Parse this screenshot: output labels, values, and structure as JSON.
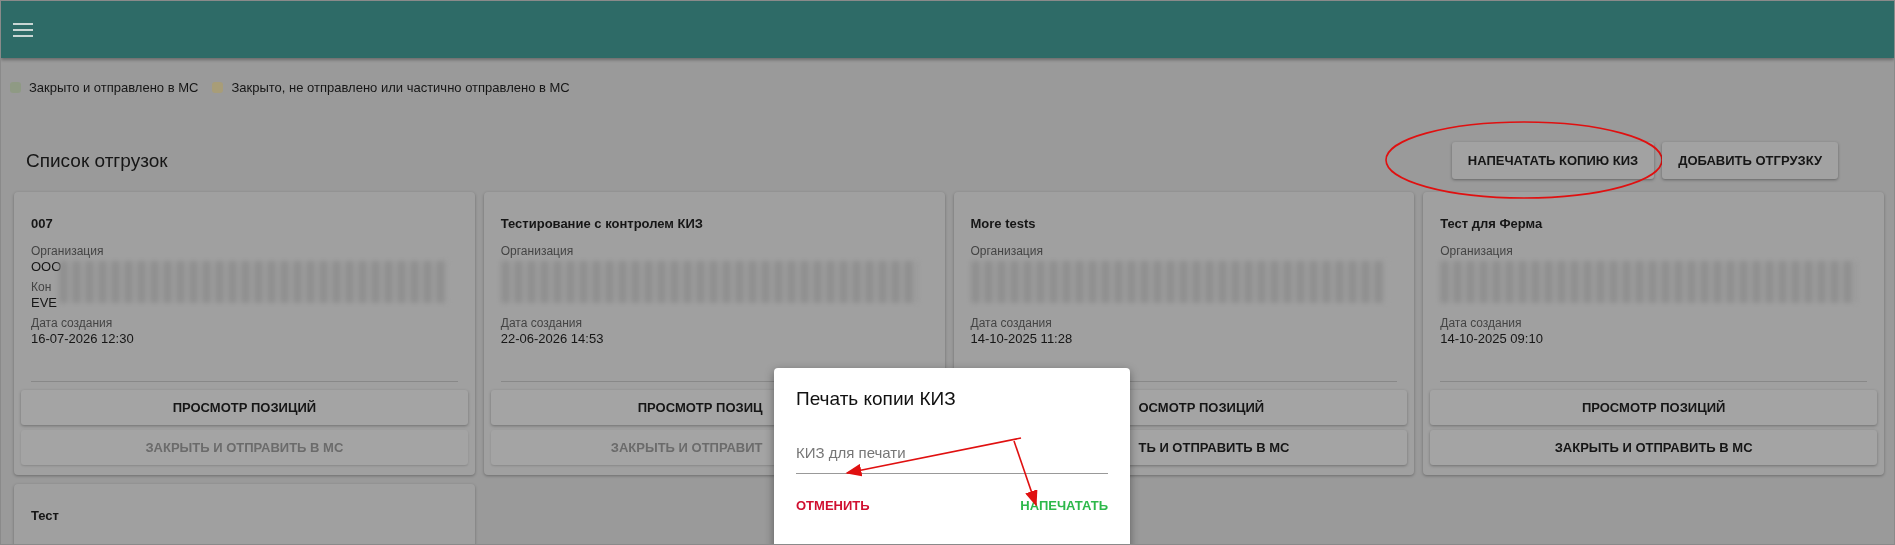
{
  "legend": [
    {
      "label": "Закрыто и отправлено в МС",
      "color": "#8f9a84"
    },
    {
      "label": "Закрыто, не отправлено или частично отправлено в МС",
      "color": "#a89d78"
    }
  ],
  "page_title": "Список отгрузок",
  "actions": [
    {
      "label": "НАПЕЧАТАТЬ КОПИЮ КИЗ",
      "circled": true
    },
    {
      "label": "ДОБАВИТЬ ОТГРУЗКУ",
      "circled": false
    }
  ],
  "cards": [
    {
      "title": "007",
      "org_label": "Организация",
      "org_value": "ООО",
      "contractor_label": "Кон",
      "contractor_value": "EVE",
      "date_label": "Дата создания",
      "date": "16-07-2026 12:30",
      "buttons": [
        {
          "label": "ПРОСМОТР ПОЗИЦИЙ",
          "disabled": false,
          "kind": "whole"
        },
        {
          "label": "ЗАКРЫТЬ И ОТПРАВИТЬ В МС",
          "disabled": true,
          "kind": "whole"
        }
      ]
    },
    {
      "title": "Тестирование с контролем КИЗ",
      "org_label": "Организация",
      "date_label": "Дата создания",
      "date": "22-06-2026 14:53",
      "buttons": [
        {
          "label": "ПРОСМОТР ПОЗИЦ",
          "disabled": false,
          "kind": "head"
        },
        {
          "label": "ЗАКРЫТЬ И ОТПРАВИТ",
          "disabled": true,
          "kind": "head"
        }
      ]
    },
    {
      "title": "More tests",
      "org_label": "Организация",
      "date_label": "Дата создания",
      "date": "14-10-2025 11:28",
      "buttons": [
        {
          "label": "ОСМОТР ПОЗИЦИЙ",
          "disabled": false,
          "kind": "tail"
        },
        {
          "label": "ТЬ И ОТПРАВИТЬ В МС",
          "disabled": false,
          "kind": "tail"
        }
      ]
    },
    {
      "title": "Тест для Ферма",
      "org_label": "Организация",
      "date_label": "Дата создания",
      "date": "14-10-2025 09:10",
      "buttons": [
        {
          "label": "ПРОСМОТР ПОЗИЦИЙ",
          "disabled": false,
          "kind": "whole"
        },
        {
          "label": "ЗАКРЫТЬ И ОТПРАВИТЬ В МС",
          "disabled": false,
          "kind": "whole"
        }
      ]
    },
    {
      "title": "Тест"
    }
  ],
  "dialog": {
    "title": "Печать копии КИЗ",
    "placeholder": "КИЗ для печати",
    "buttons": [
      {
        "label": "ОТМЕНИТЬ",
        "kind": "cancel"
      },
      {
        "label": "НАПЕЧАТАТЬ",
        "kind": "confirm"
      }
    ]
  }
}
